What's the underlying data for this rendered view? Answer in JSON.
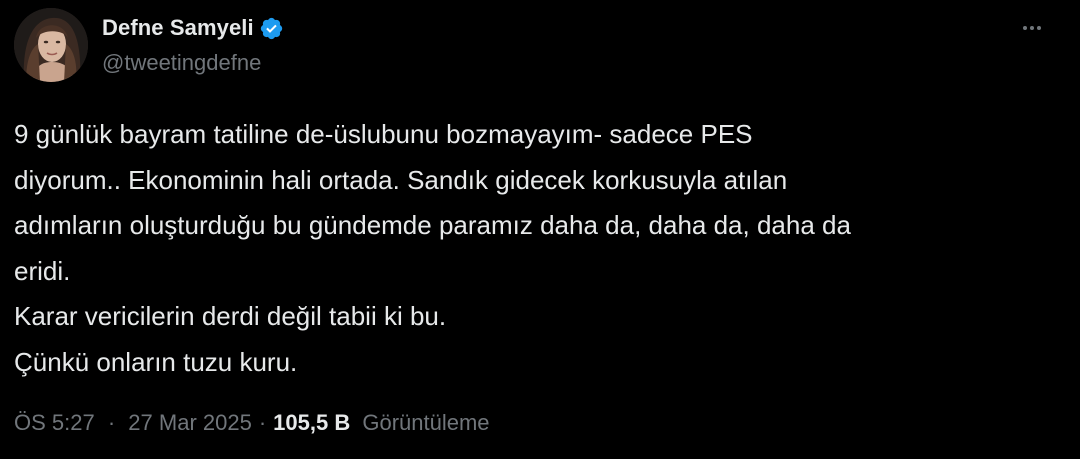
{
  "author": {
    "display_name": "Defne Samyeli",
    "handle": "@tweetingdefne",
    "verified": true,
    "avatar_icon": "user-avatar-photo",
    "verified_icon": "verified-badge-icon",
    "badge_color": "#1d9bf0"
  },
  "more_icon": "more-options-icon",
  "tweet": {
    "lines": [
      "9 günlük bayram tatiline de-üslubunu bozmayayım- sadece PES",
      "diyorum.. Ekonominin hali ortada. Sandık gidecek korkusuyla atılan",
      "adımların oluşturduğu bu gündemde paramız daha da, daha da, daha da",
      "eridi.",
      "Karar vericilerin derdi değil tabii ki bu.",
      "Çünkü onların tuzu kuru."
    ]
  },
  "meta": {
    "time": "ÖS 5:27",
    "separator": "·",
    "date": "27 Mar 2025",
    "views_count": "105,5 B",
    "views_label": "Görüntüleme"
  },
  "colors": {
    "background": "#000000",
    "primary_text": "#e7e9ea",
    "secondary_text": "#71767b",
    "accent": "#1d9bf0"
  }
}
